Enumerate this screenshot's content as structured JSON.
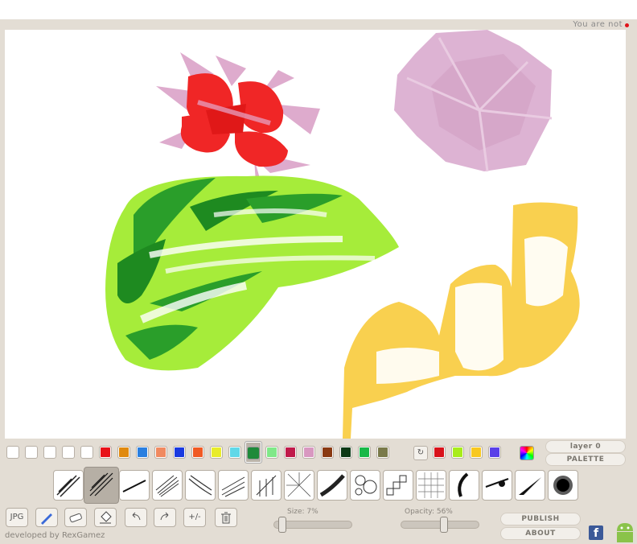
{
  "header": {
    "status_text": "You are not",
    "status_color": "#e0141a"
  },
  "canvas": {
    "name": "drawing-canvas",
    "strokes": [
      "red-flower",
      "green-leaf",
      "pink-flower",
      "yellow-hills"
    ]
  },
  "palette": {
    "swatches": [
      "#ffffff",
      "#ffffff",
      "#ffffff",
      "#ffffff",
      "#ffffff",
      "#e8121a",
      "#e08a10",
      "#2a7fe0",
      "#f08a60",
      "#1a3ae0",
      "#f05a24",
      "#e8ec2a",
      "#60d8e8",
      "#1e8a3a",
      "#80e888",
      "#c01a4a",
      "#d898c0",
      "#8a3a12",
      "#0e3a16",
      "#18b848",
      "#7a7a4a"
    ],
    "selected_index": 13,
    "recent": [
      "#d8121a",
      "#a8ec1a",
      "#f8c820",
      "#5a40e8"
    ],
    "layer_label": "layer 0",
    "palette_label": "PALETTE"
  },
  "brushes": {
    "names": [
      "brush-hatch-1",
      "brush-hatch-2",
      "brush-line",
      "brush-sketch",
      "brush-curves",
      "brush-parallel",
      "brush-fur",
      "brush-web",
      "brush-ribbon",
      "brush-circles",
      "brush-squares",
      "brush-grid",
      "brush-crescent",
      "brush-pen",
      "brush-wedge",
      "brush-spray"
    ],
    "selected_index": 1
  },
  "toolbar": {
    "jpg_label": "JPG",
    "plus_minus_label": "+/-",
    "size_label": "Size: 7%",
    "size_value": 7,
    "opacity_label": "Opacity: 56%",
    "opacity_value": 56,
    "publish_label": "PUBLISH",
    "about_label": "ABOUT"
  },
  "footer": {
    "developer": "developed by RexGamez",
    "facebook_letter": "f"
  }
}
